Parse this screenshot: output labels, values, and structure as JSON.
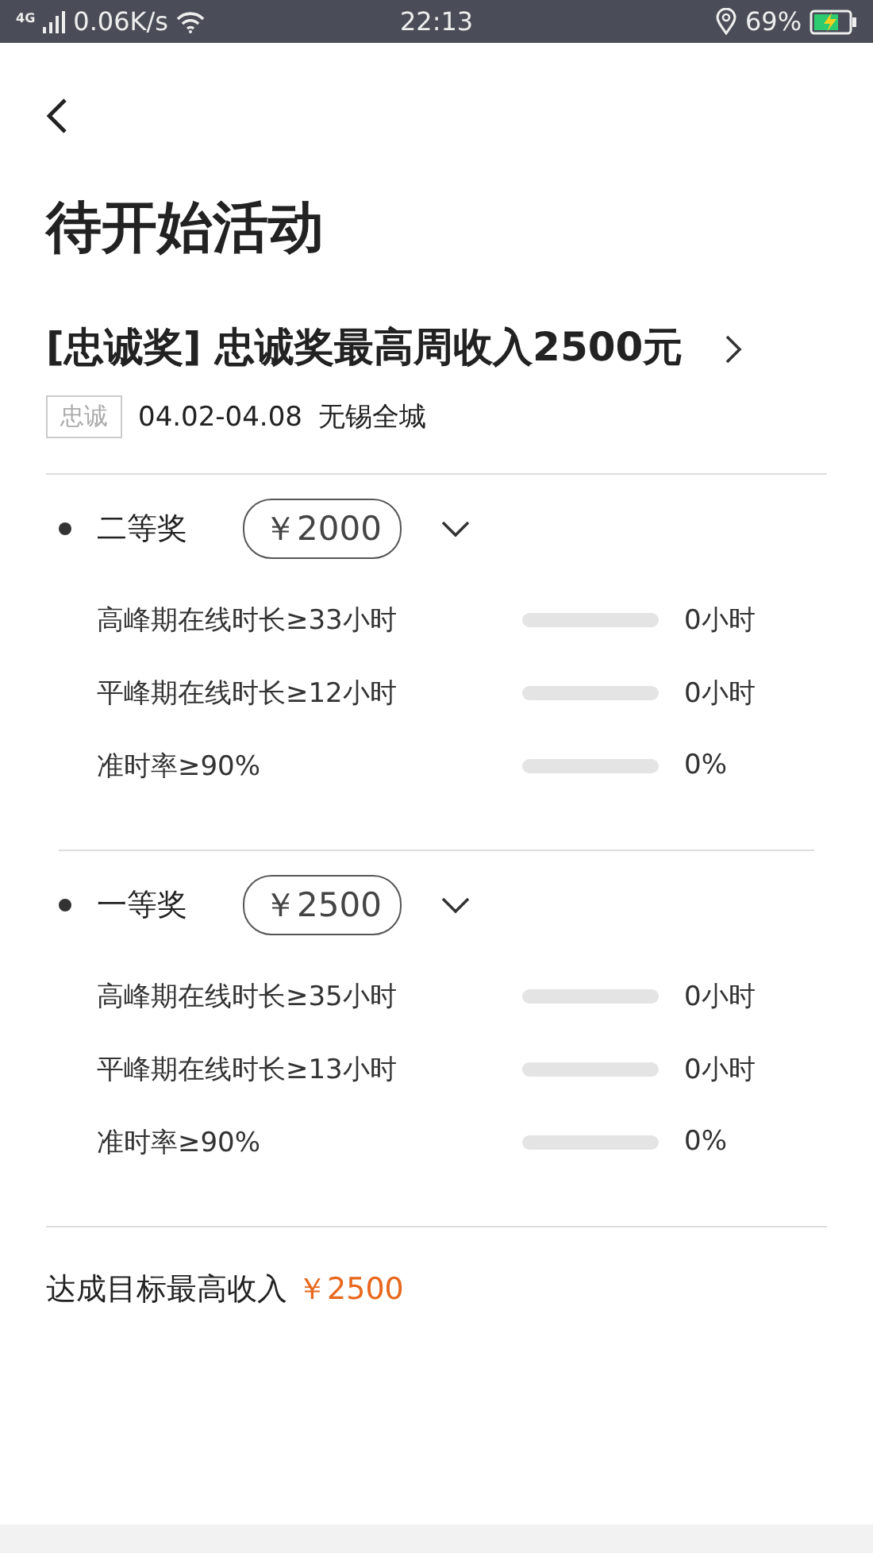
{
  "status_bar": {
    "network": "4G",
    "speed": "0.06K/s",
    "time": "22:13",
    "battery": "69%"
  },
  "page_title": "待开始活动",
  "activity": {
    "title": "[忠诚奖] 忠诚奖最高周收入2500元",
    "tag": "忠诚",
    "dates": "04.02-04.08",
    "area": "无锡全城"
  },
  "tiers": [
    {
      "name": "二等奖",
      "reward": "￥2000",
      "expanded": true,
      "criteria": [
        {
          "label": "高峰期在线时长≥33小时",
          "level": 0,
          "reading": "0小时"
        },
        {
          "label": "平峰期在线时长≥12小时",
          "level": 0,
          "reading": "0小时"
        },
        {
          "label": "准时率≥90%",
          "level": 0,
          "reading": "0%"
        }
      ]
    },
    {
      "name": "一等奖",
      "reward": "￥2500",
      "expanded": true,
      "criteria": [
        {
          "label": "高峰期在线时长≥35小时",
          "level": 0,
          "reading": "0小时"
        },
        {
          "label": "平峰期在线时长≥13小时",
          "level": 0,
          "reading": "0小时"
        },
        {
          "label": "准时率≥90%",
          "level": 0,
          "reading": "0%"
        }
      ]
    }
  ],
  "footer": {
    "label": "达成目标最高收入",
    "amount": "￥2500"
  }
}
